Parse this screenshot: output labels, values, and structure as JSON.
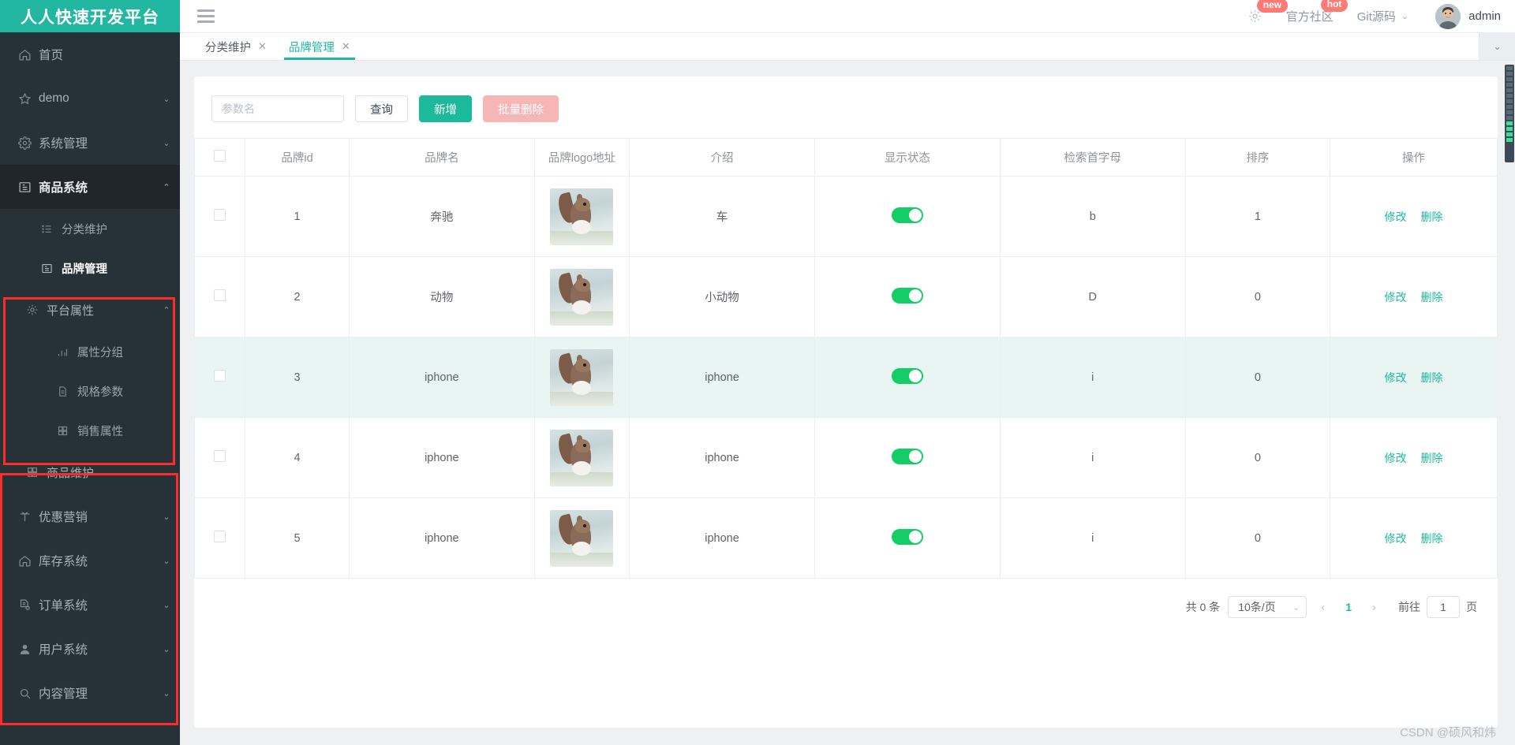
{
  "brand": {
    "title": "人人快速开发平台",
    "color": "#21b7a1"
  },
  "header": {
    "menu_toggle": "hamburger-icon",
    "settings_badge": "new",
    "community_label": "官方社区",
    "community_badge": "hot",
    "git_label": "Git源码",
    "user_name": "admin"
  },
  "sidebar": {
    "items": [
      {
        "label": "首页",
        "icon": "home-icon",
        "arrow": ""
      },
      {
        "label": "demo",
        "icon": "star-icon",
        "arrow": "⌄"
      },
      {
        "label": "系统管理",
        "icon": "gear-icon",
        "arrow": "⌄"
      },
      {
        "label": "商品系统",
        "icon": "book-icon",
        "arrow": "⌃"
      }
    ],
    "product_children": [
      {
        "label": "分类维护",
        "icon": "list-icon"
      },
      {
        "label": "品牌管理",
        "icon": "book-icon"
      }
    ],
    "platform_attr": {
      "label": "平台属性",
      "icon": "gear-icon",
      "arrow": "⌃"
    },
    "platform_children": [
      {
        "label": "属性分组",
        "icon": "bar-chart-icon"
      },
      {
        "label": "规格参数",
        "icon": "document-icon"
      },
      {
        "label": "销售属性",
        "icon": "grid-icon"
      }
    ],
    "goods_maintain": {
      "label": "商品维护",
      "icon": "grid-icon",
      "arrow": "⌄"
    },
    "bottom_items": [
      {
        "label": "优惠营销",
        "icon": "coupon-icon",
        "arrow": "⌄"
      },
      {
        "label": "库存系统",
        "icon": "home-icon",
        "arrow": "⌄"
      },
      {
        "label": "订单系统",
        "icon": "order-icon",
        "arrow": "⌄"
      },
      {
        "label": "用户系统",
        "icon": "user-icon",
        "arrow": "⌄"
      },
      {
        "label": "内容管理",
        "icon": "search-icon",
        "arrow": "⌄"
      }
    ]
  },
  "tabs": {
    "items": [
      {
        "label": "分类维护",
        "active": false
      },
      {
        "label": "品牌管理",
        "active": true
      }
    ],
    "close_glyph": "✕",
    "more_glyph": "⌄"
  },
  "toolbar": {
    "search_placeholder": "参数名",
    "search_value": "",
    "query_label": "查询",
    "add_label": "新增",
    "batch_delete_label": "批量删除"
  },
  "table": {
    "columns": [
      "",
      "品牌id",
      "品牌名",
      "品牌logo地址",
      "介绍",
      "显示状态",
      "检索首字母",
      "排序",
      "操作"
    ],
    "rows": [
      {
        "id": "1",
        "name": "奔驰",
        "logo": "squirrel-photo",
        "intro": "车",
        "status": true,
        "letter": "b",
        "sort": "1",
        "highlight": false
      },
      {
        "id": "2",
        "name": "动物",
        "logo": "squirrel-photo",
        "intro": "小动物",
        "status": true,
        "letter": "D",
        "sort": "0",
        "highlight": false
      },
      {
        "id": "3",
        "name": "iphone",
        "logo": "squirrel-photo",
        "intro": "iphone",
        "status": true,
        "letter": "i",
        "sort": "0",
        "highlight": true
      },
      {
        "id": "4",
        "name": "iphone",
        "logo": "squirrel-photo",
        "intro": "iphone",
        "status": true,
        "letter": "i",
        "sort": "0",
        "highlight": false
      },
      {
        "id": "5",
        "name": "iphone",
        "logo": "squirrel-photo",
        "intro": "iphone",
        "status": true,
        "letter": "i",
        "sort": "0",
        "highlight": false
      }
    ],
    "edit_label": "修改",
    "delete_label": "删除"
  },
  "pagination": {
    "total_text": "共 0 条",
    "page_size": "10条/页",
    "prev_glyph": "‹",
    "next_glyph": "›",
    "current_page": "1",
    "jump_prefix": "前往",
    "jump_value": "1",
    "jump_suffix": "页"
  },
  "watermark": "CSDN @硕风和炜"
}
